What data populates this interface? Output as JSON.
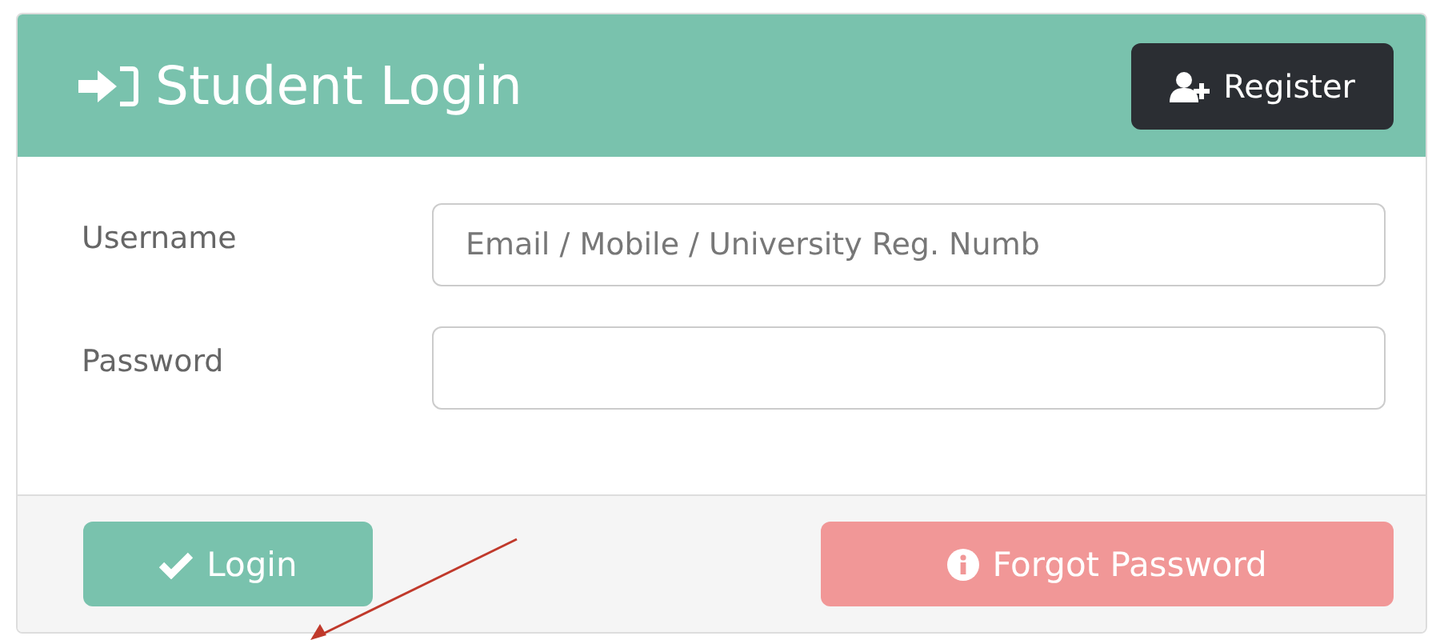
{
  "header": {
    "title": "Student Login",
    "register_button": "Register"
  },
  "fields": [
    {
      "label": "Username",
      "placeholder": "Email / Mobile / University Reg. Numb"
    },
    {
      "label": "Password"
    }
  ],
  "footer": {
    "login_button": "Login",
    "forgot_button": "Forgot Password"
  }
}
